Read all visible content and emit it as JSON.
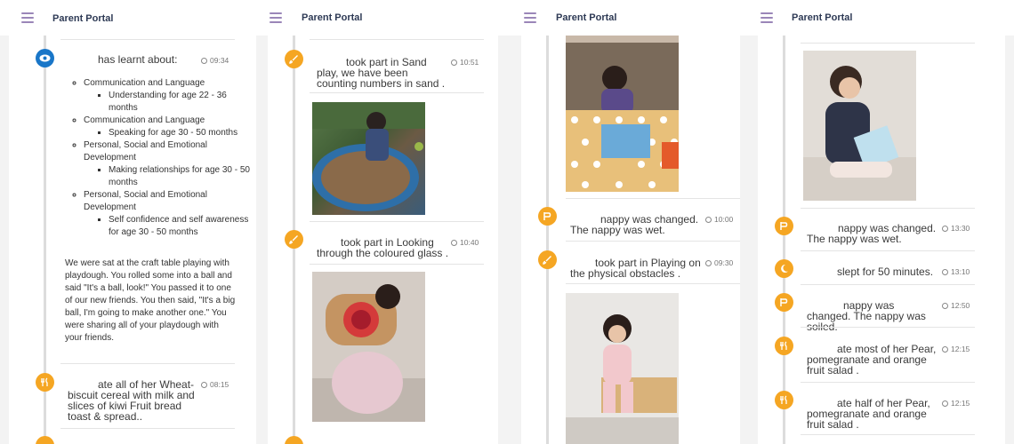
{
  "app": {
    "title": "Parent Portal"
  },
  "colors": {
    "accent": "#f5a623",
    "learning": "#1976c8",
    "menu": "#9a86b8"
  },
  "panel1": {
    "learning_text": "has learnt about:",
    "learning_time": "09:34",
    "areas": [
      {
        "area": "Communication and Language",
        "detail": "Understanding for age 22 - 36 months"
      },
      {
        "area": "Communication and Language",
        "detail": "Speaking for age 30 - 50 months"
      },
      {
        "area": "Personal, Social and Emotional Development",
        "detail": "Making relationships for age 30 - 50 months"
      },
      {
        "area": "Personal, Social and Emotional Development",
        "detail": "Self confidence and self awareness for age 30 - 50 months"
      }
    ],
    "story": "We were sat at the craft table playing with playdough. You rolled some into a ball and said \"It's a ball, look!\" You passed it to one of our new friends. You then said, \"It's a big ball, I'm going to make another one.\" You were sharing all of your playdough with your friends.",
    "meal_text": "ate all of her Wheat-biscuit cereal with milk and slices of kiwi Fruit bread toast & spread..",
    "meal_time": "08:15"
  },
  "panel2": {
    "sand_text": "took part in Sand play, we have been counting numbers in sand .",
    "sand_time": "10:51",
    "looking_text": "took part in Looking through the coloured glass .",
    "looking_time": "10:40"
  },
  "panel3": {
    "nappy_text": "nappy was changed. The nappy was wet.",
    "nappy_time": "10:00",
    "playing_text": "took part in Playing on the physical obstacles .",
    "playing_time": "09:30"
  },
  "panel4": {
    "nappy1_text": "nappy was changed. The nappy was wet.",
    "nappy1_time": "13:30",
    "sleep_text": "slept for 50 minutes.",
    "sleep_time": "13:10",
    "nappy2_text": "nappy was changed. The nappy was soiled.",
    "nappy2_time": "12:50",
    "pear1_text": "ate most of her Pear, pomegranate and orange fruit salad .",
    "pear1_time": "12:15",
    "pear2_text": "ate half of her Pear, pomegranate and orange fruit salad .",
    "pear2_time": "12:15"
  }
}
